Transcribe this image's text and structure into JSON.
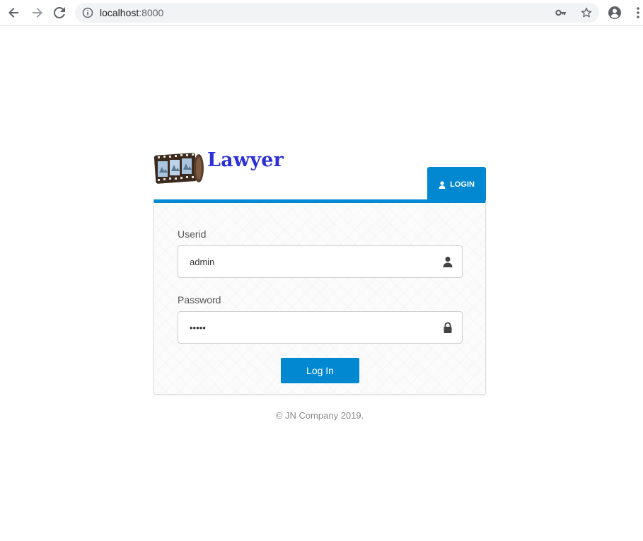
{
  "browser": {
    "url_host": "localhost",
    "url_port": ":8000"
  },
  "brand": {
    "title": "Lawyer"
  },
  "tab": {
    "label": "LOGIN"
  },
  "form": {
    "userid_label": "Userid",
    "userid_value": "admin",
    "password_label": "Password",
    "password_value": "•••••",
    "submit_label": "Log In"
  },
  "footer": {
    "text": "© JN Company 2019."
  },
  "colors": {
    "accent": "#0288d1",
    "brand_title": "#2c2fd8"
  },
  "icons": {
    "back": "arrow-left-icon",
    "forward": "arrow-right-icon",
    "reload": "reload-icon",
    "info": "info-icon",
    "key": "key-icon",
    "star": "star-icon",
    "account": "account-icon",
    "menu": "more-vert-icon",
    "user": "user-icon",
    "lock": "lock-icon"
  }
}
